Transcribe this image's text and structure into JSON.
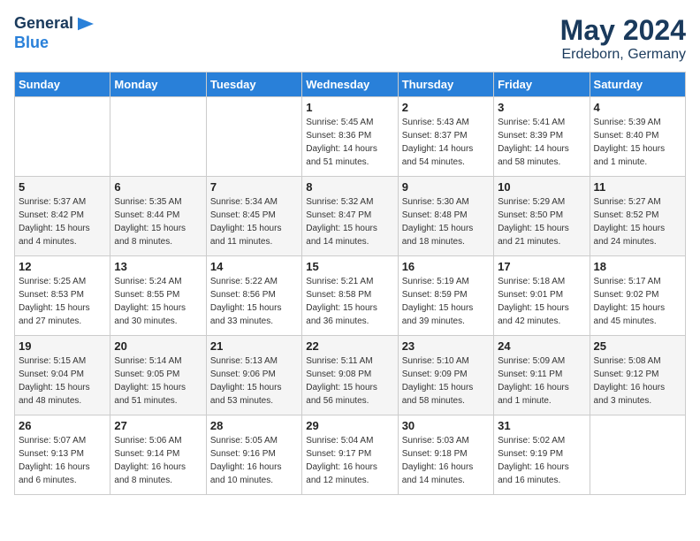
{
  "header": {
    "logo_line1": "General",
    "logo_line2": "Blue",
    "month_year": "May 2024",
    "location": "Erdeborn, Germany"
  },
  "days_of_week": [
    "Sunday",
    "Monday",
    "Tuesday",
    "Wednesday",
    "Thursday",
    "Friday",
    "Saturday"
  ],
  "weeks": [
    [
      {
        "day": "",
        "info": ""
      },
      {
        "day": "",
        "info": ""
      },
      {
        "day": "",
        "info": ""
      },
      {
        "day": "1",
        "info": "Sunrise: 5:45 AM\nSunset: 8:36 PM\nDaylight: 14 hours\nand 51 minutes."
      },
      {
        "day": "2",
        "info": "Sunrise: 5:43 AM\nSunset: 8:37 PM\nDaylight: 14 hours\nand 54 minutes."
      },
      {
        "day": "3",
        "info": "Sunrise: 5:41 AM\nSunset: 8:39 PM\nDaylight: 14 hours\nand 58 minutes."
      },
      {
        "day": "4",
        "info": "Sunrise: 5:39 AM\nSunset: 8:40 PM\nDaylight: 15 hours\nand 1 minute."
      }
    ],
    [
      {
        "day": "5",
        "info": "Sunrise: 5:37 AM\nSunset: 8:42 PM\nDaylight: 15 hours\nand 4 minutes."
      },
      {
        "day": "6",
        "info": "Sunrise: 5:35 AM\nSunset: 8:44 PM\nDaylight: 15 hours\nand 8 minutes."
      },
      {
        "day": "7",
        "info": "Sunrise: 5:34 AM\nSunset: 8:45 PM\nDaylight: 15 hours\nand 11 minutes."
      },
      {
        "day": "8",
        "info": "Sunrise: 5:32 AM\nSunset: 8:47 PM\nDaylight: 15 hours\nand 14 minutes."
      },
      {
        "day": "9",
        "info": "Sunrise: 5:30 AM\nSunset: 8:48 PM\nDaylight: 15 hours\nand 18 minutes."
      },
      {
        "day": "10",
        "info": "Sunrise: 5:29 AM\nSunset: 8:50 PM\nDaylight: 15 hours\nand 21 minutes."
      },
      {
        "day": "11",
        "info": "Sunrise: 5:27 AM\nSunset: 8:52 PM\nDaylight: 15 hours\nand 24 minutes."
      }
    ],
    [
      {
        "day": "12",
        "info": "Sunrise: 5:25 AM\nSunset: 8:53 PM\nDaylight: 15 hours\nand 27 minutes."
      },
      {
        "day": "13",
        "info": "Sunrise: 5:24 AM\nSunset: 8:55 PM\nDaylight: 15 hours\nand 30 minutes."
      },
      {
        "day": "14",
        "info": "Sunrise: 5:22 AM\nSunset: 8:56 PM\nDaylight: 15 hours\nand 33 minutes."
      },
      {
        "day": "15",
        "info": "Sunrise: 5:21 AM\nSunset: 8:58 PM\nDaylight: 15 hours\nand 36 minutes."
      },
      {
        "day": "16",
        "info": "Sunrise: 5:19 AM\nSunset: 8:59 PM\nDaylight: 15 hours\nand 39 minutes."
      },
      {
        "day": "17",
        "info": "Sunrise: 5:18 AM\nSunset: 9:01 PM\nDaylight: 15 hours\nand 42 minutes."
      },
      {
        "day": "18",
        "info": "Sunrise: 5:17 AM\nSunset: 9:02 PM\nDaylight: 15 hours\nand 45 minutes."
      }
    ],
    [
      {
        "day": "19",
        "info": "Sunrise: 5:15 AM\nSunset: 9:04 PM\nDaylight: 15 hours\nand 48 minutes."
      },
      {
        "day": "20",
        "info": "Sunrise: 5:14 AM\nSunset: 9:05 PM\nDaylight: 15 hours\nand 51 minutes."
      },
      {
        "day": "21",
        "info": "Sunrise: 5:13 AM\nSunset: 9:06 PM\nDaylight: 15 hours\nand 53 minutes."
      },
      {
        "day": "22",
        "info": "Sunrise: 5:11 AM\nSunset: 9:08 PM\nDaylight: 15 hours\nand 56 minutes."
      },
      {
        "day": "23",
        "info": "Sunrise: 5:10 AM\nSunset: 9:09 PM\nDaylight: 15 hours\nand 58 minutes."
      },
      {
        "day": "24",
        "info": "Sunrise: 5:09 AM\nSunset: 9:11 PM\nDaylight: 16 hours\nand 1 minute."
      },
      {
        "day": "25",
        "info": "Sunrise: 5:08 AM\nSunset: 9:12 PM\nDaylight: 16 hours\nand 3 minutes."
      }
    ],
    [
      {
        "day": "26",
        "info": "Sunrise: 5:07 AM\nSunset: 9:13 PM\nDaylight: 16 hours\nand 6 minutes."
      },
      {
        "day": "27",
        "info": "Sunrise: 5:06 AM\nSunset: 9:14 PM\nDaylight: 16 hours\nand 8 minutes."
      },
      {
        "day": "28",
        "info": "Sunrise: 5:05 AM\nSunset: 9:16 PM\nDaylight: 16 hours\nand 10 minutes."
      },
      {
        "day": "29",
        "info": "Sunrise: 5:04 AM\nSunset: 9:17 PM\nDaylight: 16 hours\nand 12 minutes."
      },
      {
        "day": "30",
        "info": "Sunrise: 5:03 AM\nSunset: 9:18 PM\nDaylight: 16 hours\nand 14 minutes."
      },
      {
        "day": "31",
        "info": "Sunrise: 5:02 AM\nSunset: 9:19 PM\nDaylight: 16 hours\nand 16 minutes."
      },
      {
        "day": "",
        "info": ""
      }
    ]
  ]
}
